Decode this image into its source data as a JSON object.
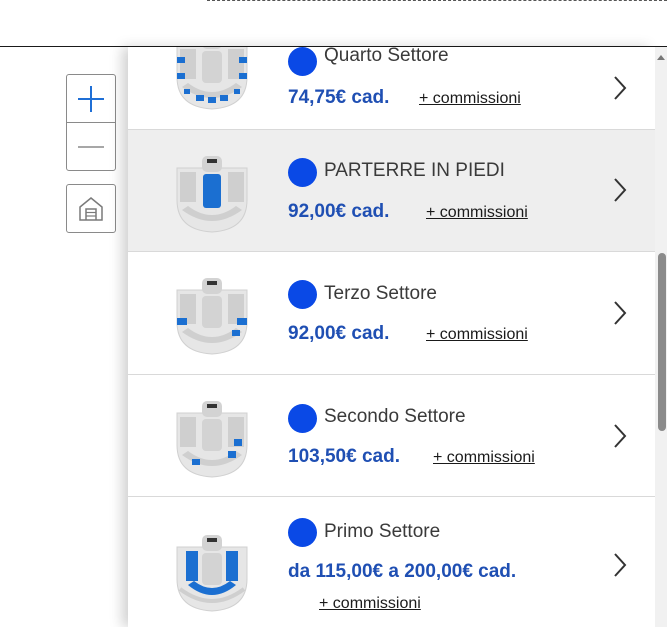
{
  "sectors": [
    {
      "name": "Quarto Settore",
      "price": "74,75€ cad.",
      "commission": "+ commissioni",
      "highlighted": false
    },
    {
      "name": "PARTERRE IN PIEDI",
      "price": "92,00€ cad.",
      "commission": "+ commissioni",
      "highlighted": true
    },
    {
      "name": "Terzo Settore",
      "price": "92,00€ cad.",
      "commission": "+ commissioni",
      "highlighted": false
    },
    {
      "name": "Secondo Settore",
      "price": "103,50€ cad.",
      "commission": "+ commissioni",
      "highlighted": false
    },
    {
      "name": "Primo Settore",
      "price": "da 115,00€ a 200,00€ cad.",
      "commission": "+ commissioni",
      "highlighted": false
    }
  ],
  "colors": {
    "accent": "#0a49e6",
    "price": "#1f4fb3",
    "highlight_row": "#eeeeee",
    "venue_gray": "#cfcfcf",
    "venue_blue": "#1b6fd1"
  },
  "icons": {
    "zoom_in": "plus-icon",
    "zoom_out": "minus-icon",
    "home": "home-icon",
    "row_arrow": "chevron-right-icon"
  }
}
